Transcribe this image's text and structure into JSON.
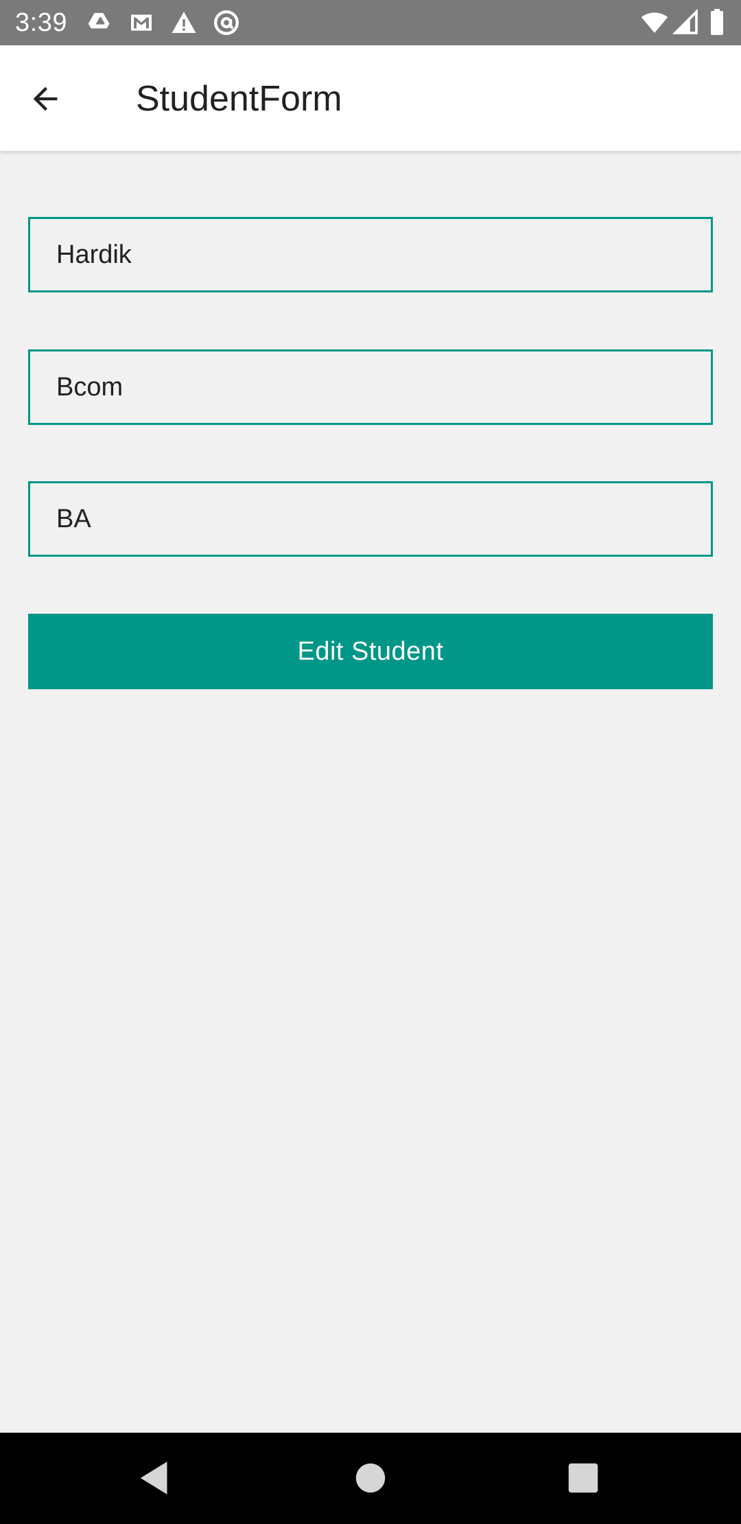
{
  "status_bar": {
    "time": "3:39",
    "left_icons": [
      "drive-icon",
      "gmail-icon",
      "warning-icon",
      "at-sign-icon"
    ],
    "right_icons": [
      "wifi-icon",
      "cell-signal-icon",
      "battery-icon"
    ]
  },
  "app_bar": {
    "title": "StudentForm",
    "back_icon": "arrow-left-icon"
  },
  "form": {
    "fields": [
      {
        "value": "Hardik"
      },
      {
        "value": "Bcom"
      },
      {
        "value": "BA"
      }
    ],
    "submit_label": "Edit Student"
  },
  "nav_bar": {
    "buttons": [
      "back-triangle-icon",
      "home-circle-icon",
      "recents-square-icon"
    ]
  },
  "colors": {
    "accent": "#009688",
    "status_bar": "#7a7a7a",
    "background": "#f1f1f1",
    "nav_bar": "#000000"
  }
}
